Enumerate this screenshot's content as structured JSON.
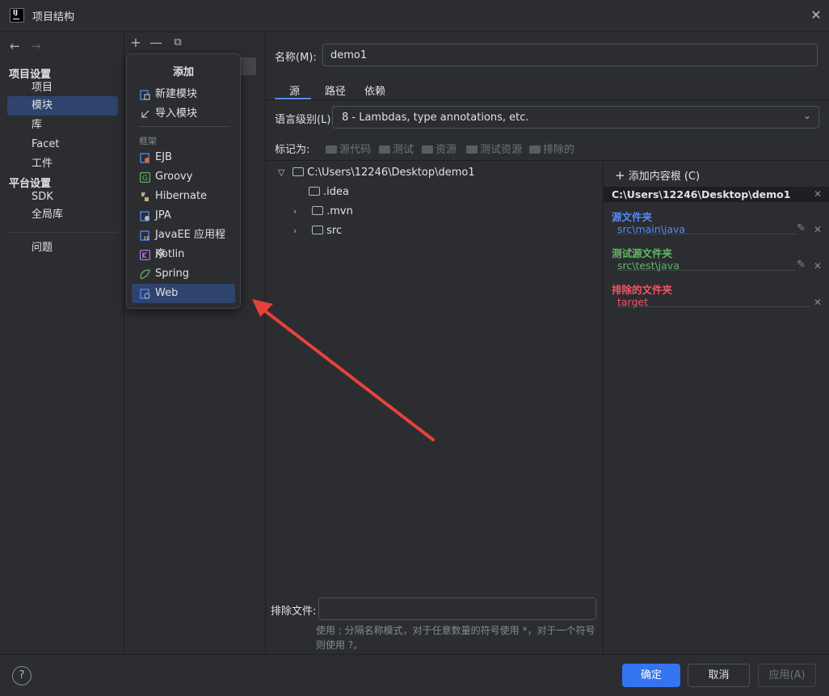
{
  "window": {
    "title": "项目结构"
  },
  "nav": {
    "project_settings_header": "项目设置",
    "items_project": [
      {
        "label": "项目"
      },
      {
        "label": "模块"
      },
      {
        "label": "库"
      },
      {
        "label": "Facet"
      },
      {
        "label": "工件"
      }
    ],
    "platform_settings_header": "平台设置",
    "items_platform": [
      {
        "label": "SDK"
      },
      {
        "label": "全局库"
      }
    ],
    "problems_label": "问题",
    "selected": "模块"
  },
  "popup": {
    "title": "添加",
    "items": [
      {
        "label": "新建模块",
        "icon": "new-module-icon"
      },
      {
        "label": "导入模块",
        "icon": "import-module-icon"
      }
    ],
    "group_label": "框架",
    "framework_items": [
      {
        "label": "EJB",
        "icon": "ejb-icon"
      },
      {
        "label": "Groovy",
        "icon": "groovy-icon"
      },
      {
        "label": "Hibernate",
        "icon": "hibernate-icon"
      },
      {
        "label": "JPA",
        "icon": "jpa-icon"
      },
      {
        "label": "JavaEE 应用程序",
        "icon": "javaee-icon"
      },
      {
        "label": "Kotlin",
        "icon": "kotlin-icon"
      },
      {
        "label": "Spring",
        "icon": "spring-icon"
      },
      {
        "label": "Web",
        "icon": "web-icon"
      }
    ],
    "selected": "Web"
  },
  "module": {
    "name_label": "名称(M):",
    "name_value": "demo1",
    "tabs": [
      {
        "label": "源"
      },
      {
        "label": "路径"
      },
      {
        "label": "依赖"
      }
    ],
    "active_tab": "源",
    "language_level_label": "语言级别(L):",
    "language_level_value": "8 - Lambdas, type annotations, etc.",
    "mark_as_label": "标记为:",
    "mark_buttons": [
      {
        "label": "源代码"
      },
      {
        "label": "测试"
      },
      {
        "label": "资源"
      },
      {
        "label": "测试资源"
      },
      {
        "label": "排除的"
      }
    ],
    "tree": {
      "root": "C:\\Users\\12246\\Desktop\\demo1",
      "children": [
        {
          "label": ".idea",
          "expandable": false
        },
        {
          "label": ".mvn",
          "expandable": true
        },
        {
          "label": "src",
          "expandable": true
        }
      ]
    },
    "content_root": {
      "add_label": "添加内容根 (C)",
      "path": "C:\\Users\\12246\\Desktop\\demo1",
      "source_title": "源文件夹",
      "source_path": "src\\main\\java",
      "test_title": "测试源文件夹",
      "test_path": "src\\test\\java",
      "excluded_title": "排除的文件夹",
      "excluded_path": "target"
    },
    "exclude_files_label": "排除文件:",
    "exclude_files_value": "",
    "exclude_hint": "使用 ; 分隔名称模式，对于任意数量的符号使用 *，对于一个符号则使用 ?。"
  },
  "footer": {
    "ok": "确定",
    "cancel": "取消",
    "apply": "应用(A)",
    "help": "?"
  },
  "colors": {
    "accent": "#3574f0",
    "selection": "#2e436e",
    "source_folder": "#548af7",
    "test_folder": "#5fb865",
    "excluded_folder": "#f75464",
    "arrow": "#e8413c"
  }
}
